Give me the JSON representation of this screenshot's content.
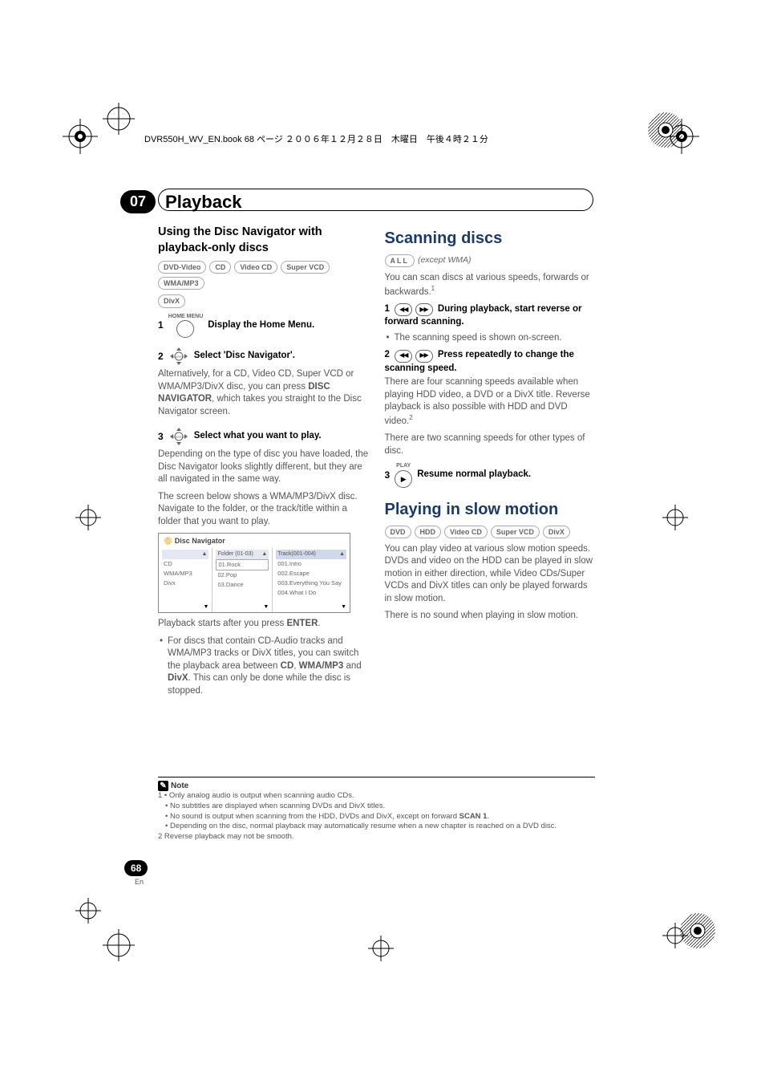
{
  "header_line": "DVR550H_WV_EN.book 68 ページ ２００６年１２月２８日　木曜日　午後４時２１分",
  "chapter": {
    "num": "07",
    "title": "Playback"
  },
  "col1": {
    "section_title_line1": "Using the Disc Navigator with",
    "section_title_line2": "playback-only discs",
    "badges": [
      "DVD-Video",
      "CD",
      "Video CD",
      "Super VCD",
      "WMA/MP3",
      "DivX"
    ],
    "step1": {
      "num": "1",
      "iconlabel": "HOME MENU",
      "text": "Display the Home Menu."
    },
    "step2": {
      "num": "2",
      "text": "Select 'Disc Navigator'."
    },
    "step2_body": "Alternatively, for a CD, Video CD, Super VCD or WMA/MP3/DivX disc, you can press ",
    "step2_body_bold1": "DISC NAVIGATOR",
    "step2_body_cont": ", which takes you straight to the Disc Navigator screen.",
    "step3": {
      "num": "3",
      "text": "Select what you want to play."
    },
    "step3_body1": "Depending on the type of disc you have loaded, the Disc Navigator looks slightly different, but they are all navigated in the same way.",
    "step3_body2": "The screen below shows a WMA/MP3/DivX disc. Navigate to the folder, or the track/title within a folder that you want to play.",
    "discnav": {
      "title": "Disc Navigator",
      "col1header": "",
      "col1items": [
        "CD",
        "WMA/MP3",
        "Divx"
      ],
      "col2header": "Folder (01-03)",
      "col2items": [
        "01.Rock",
        "02.Pop",
        "03.Dance"
      ],
      "col3header": "Track(001-004)",
      "col3items": [
        "001.Intro",
        "002.Escape",
        "003.Everything You Say",
        "004.What I Do"
      ]
    },
    "after_ss_1a": "Playback starts after you press ",
    "after_ss_1b": "ENTER",
    "after_ss_1c": ".",
    "bullet1a": "For discs that contain CD-Audio tracks and WMA/MP3 tracks or DivX titles, you can switch the playback area between ",
    "bullet1b": "CD",
    "bullet1c": ", ",
    "bullet1d": "WMA/MP3",
    "bullet1e": " and ",
    "bullet1f": "DivX",
    "bullet1g": ". This can only be done while the disc is stopped."
  },
  "col2": {
    "h2_scan": "Scanning discs",
    "scan_badge": "ALL",
    "scan_except": "(except WMA)",
    "scan_intro": "You can scan discs at various speeds, forwards or backwards.",
    "sup1": "1",
    "scan_s1a": "1",
    "scan_s1b": "During playback, start reverse or forward scanning.",
    "scan_s1_bullet": "The scanning speed is shown on-screen.",
    "scan_s2a": "2",
    "scan_s2b": "Press repeatedly to change the scanning speed.",
    "scan_s2_body": "There are four scanning speeds available when playing HDD video, a DVD or a DivX title. Reverse playback is also possible with HDD and DVD video.",
    "sup2": "2",
    "scan_s2_body2": "There are two scanning speeds for other types of disc.",
    "scan_s3a": "3",
    "scan_s3_label": "PLAY",
    "scan_s3b": "Resume normal playback.",
    "h2_slow": "Playing in slow motion",
    "slow_badges": [
      "DVD",
      "HDD",
      "Video CD",
      "Super VCD",
      "DivX"
    ],
    "slow_body1": "You can play video at various slow motion speeds. DVDs and video on the HDD can be played in slow motion in either direction, while Video CDs/Super VCDs and DivX titles can only be played forwards in slow motion.",
    "slow_body2": "There is no sound when playing in slow motion."
  },
  "note": {
    "label": "Note",
    "l1": "1 • Only analog audio is output when scanning audio CDs.",
    "l2": "• No subtitles are displayed when scanning DVDs and DivX titles.",
    "l3a": "• No sound is output when scanning from the HDD, DVDs and DivX, except on forward ",
    "l3b": "SCAN 1",
    "l3c": ".",
    "l4": "• Depending on the disc, normal playback may automatically resume when a new chapter is reached on a DVD disc.",
    "l5": "2 Reverse playback may not be smooth."
  },
  "page": {
    "num": "68",
    "lang": "En"
  }
}
